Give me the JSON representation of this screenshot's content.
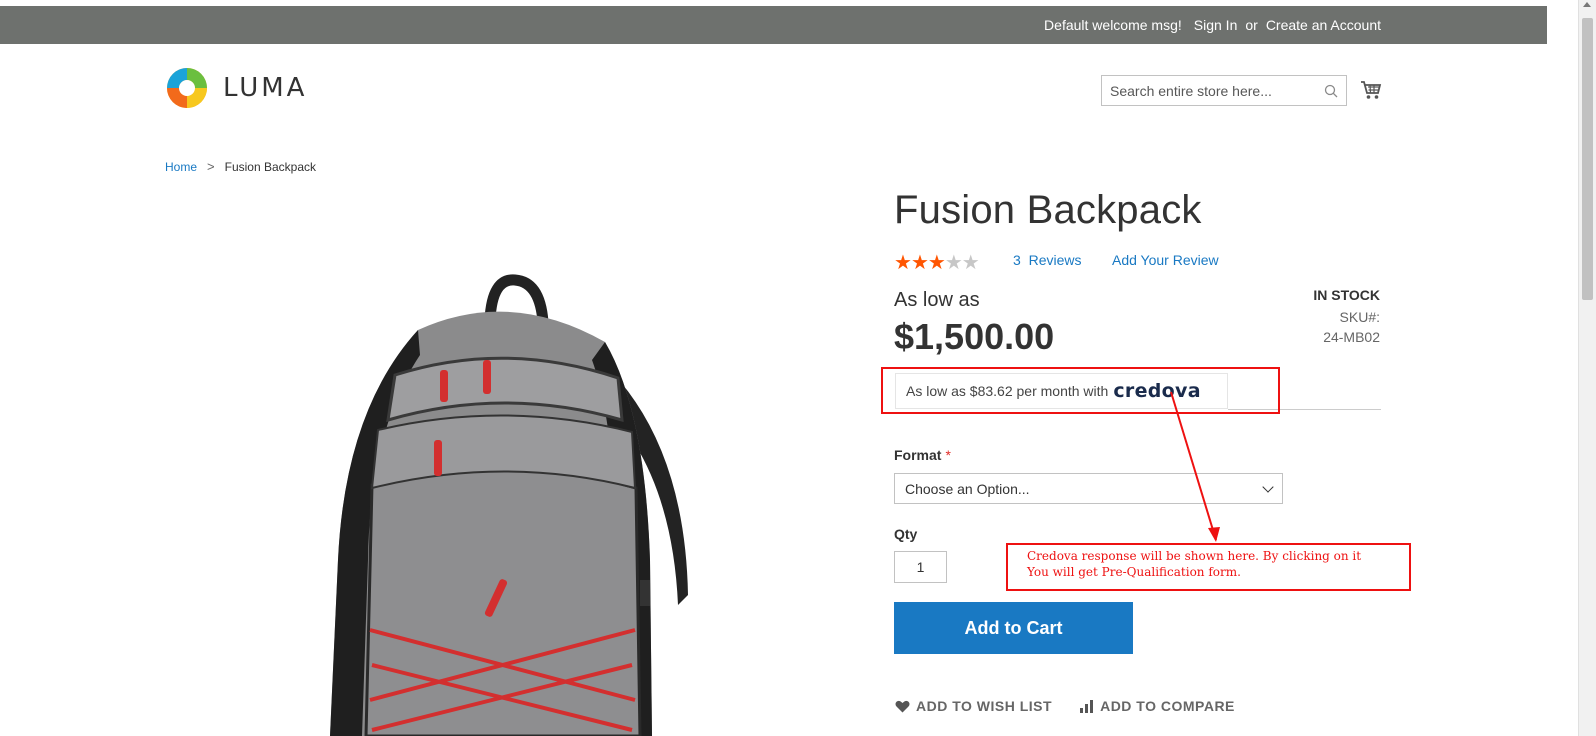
{
  "panel": {
    "welcome": "Default welcome msg!",
    "sign_in": "Sign In",
    "or": "or",
    "create_account": "Create an Account"
  },
  "header": {
    "logo_text": "LUMA",
    "search_placeholder": "Search entire store here..."
  },
  "breadcrumb": {
    "home": "Home",
    "separator": ">",
    "current": "Fusion Backpack"
  },
  "product": {
    "title": "Fusion Backpack",
    "rating_stars_filled": 3,
    "rating_stars_total": 5,
    "reviews_count": "3",
    "reviews_label": "Reviews",
    "add_review": "Add Your Review",
    "as_low_as": "As low as",
    "price": "$1,500.00",
    "stock": "IN STOCK",
    "sku_label": "SKU#:",
    "sku_value": "24-MB02",
    "credova_text": "As low as $83.62 per month with",
    "credova_brand": "credova",
    "format_label": "Format",
    "format_required": "*",
    "format_select": "Choose an Option...",
    "qty_label": "Qty",
    "qty_value": "1",
    "add_to_cart": "Add to Cart",
    "wishlist": "ADD TO WISH LIST",
    "compare": "ADD TO COMPARE"
  },
  "annotation": {
    "line1": "Credova response will be shown here. By clicking on it",
    "line2": "You will get Pre-Qualification form."
  },
  "colors": {
    "panel_bg": "#6e716e",
    "link": "#1979c3",
    "star_on": "#ff5501",
    "star_off": "#c7c7c7",
    "primary_button": "#1979c3",
    "annotation_red": "#ee1111"
  }
}
